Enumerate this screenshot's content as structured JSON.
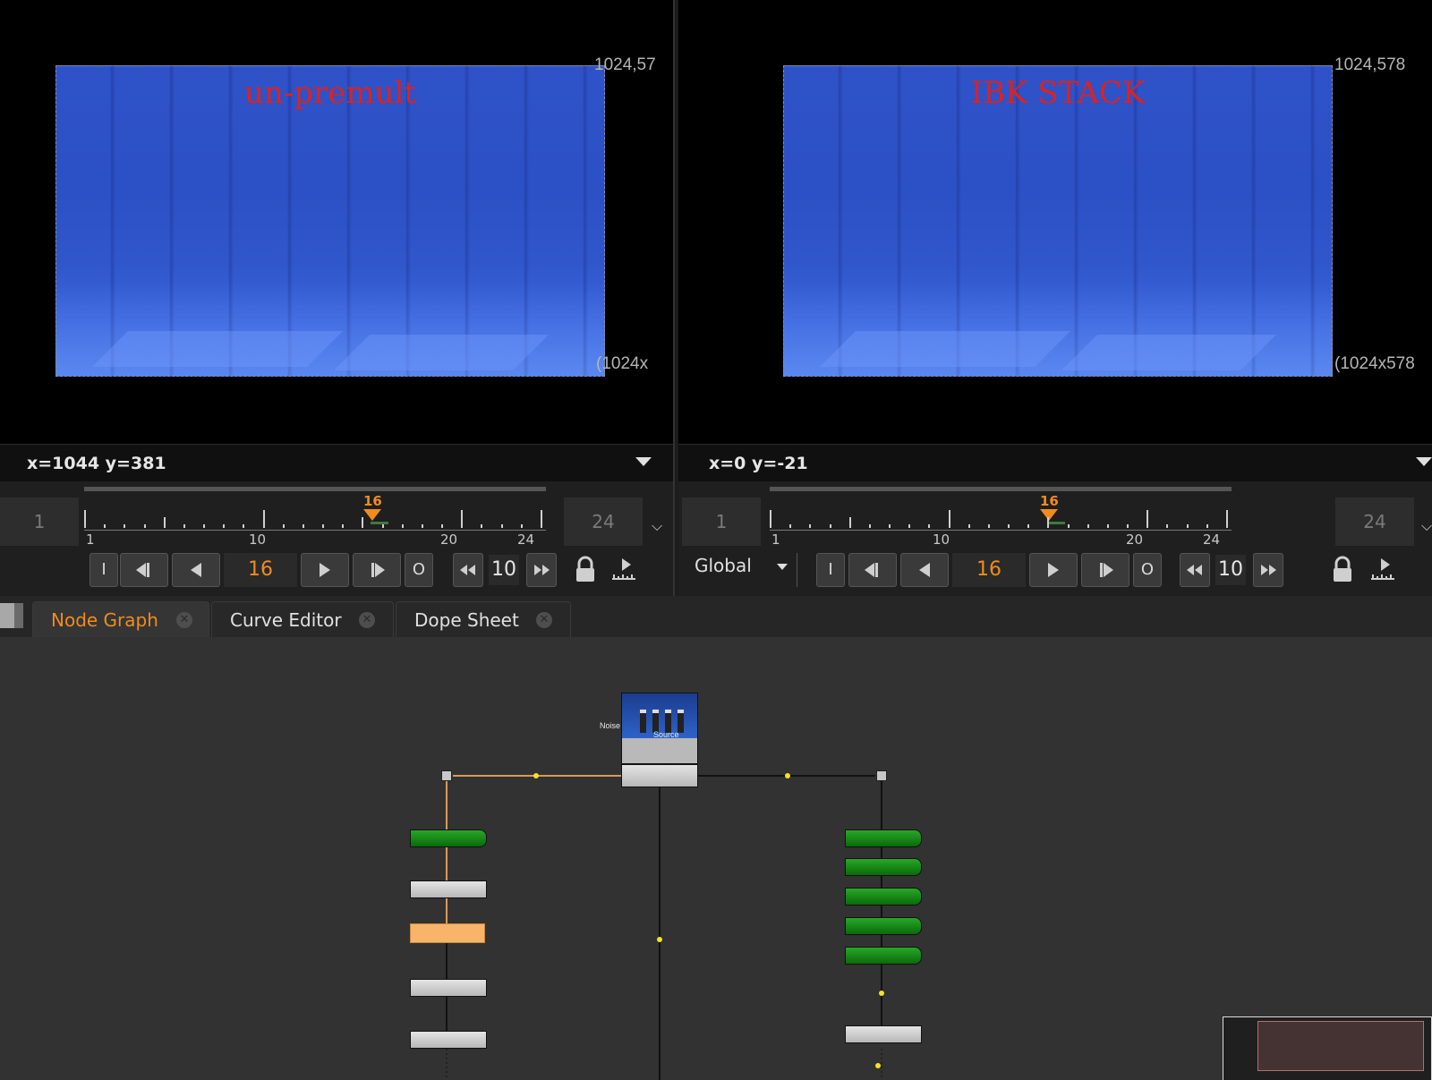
{
  "viewers": [
    {
      "id": "left",
      "image_title": "un-premult",
      "frame_top_label": "1024,57",
      "frame_bottom_label": "(1024x",
      "coords": "x=1044 y=381",
      "timeline": {
        "start_frame": "1",
        "end_frame": "24",
        "current_frame": "16",
        "tick_labels": [
          "1",
          "10",
          "20",
          "24"
        ]
      },
      "controls": {
        "in_label": "I",
        "out_label": "O",
        "frame": "16",
        "step": "10"
      }
    },
    {
      "id": "right",
      "image_title": "IBK STACK",
      "frame_top_label": "1024,578",
      "frame_bottom_label": "(1024x578",
      "coords": "x=0 y=-21",
      "timeline": {
        "start_frame": "1",
        "end_frame": "24",
        "current_frame": "16",
        "tick_labels": [
          "1",
          "10",
          "20",
          "24"
        ]
      },
      "controls": {
        "global_label": "Global",
        "in_label": "I",
        "out_label": "O",
        "frame": "16",
        "step": "10"
      }
    }
  ],
  "tabs": [
    {
      "label": "Node Graph",
      "active": true
    },
    {
      "label": "Curve Editor",
      "active": false
    },
    {
      "label": "Dope Sheet",
      "active": false
    }
  ],
  "graph": {
    "pipe_labels": {
      "noise": "Noise",
      "source": "Source"
    }
  },
  "icons": {
    "lock": "lock-icon",
    "ruler": "ruler-icon",
    "double_chevron": "double-chevron-down-icon",
    "close": "close-icon"
  },
  "colors": {
    "accent": "#f08c1e",
    "title_red": "#e0211c",
    "node_green": "#16881a",
    "node_grey": "#c8c8c8",
    "node_orange": "#f7b46a",
    "panel_bg": "#323232"
  }
}
